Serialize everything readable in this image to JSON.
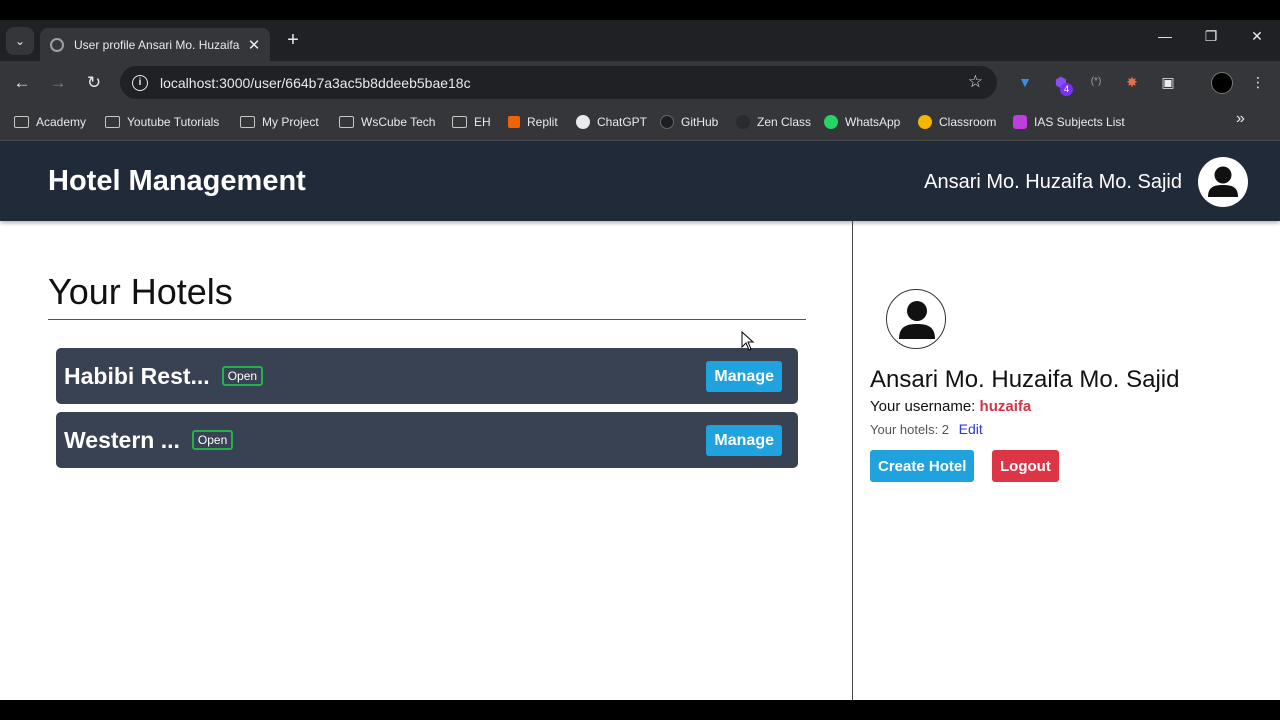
{
  "browser": {
    "tab_title": "User profile Ansari Mo. Huzaifa",
    "url": "localhost:3000/user/664b7a3ac5b8ddeeb5bae18c",
    "extension_badge_count": "4",
    "bookmarks": [
      {
        "label": "Academy",
        "icon": "folder-icon"
      },
      {
        "label": "Youtube Tutorials",
        "icon": "folder-icon"
      },
      {
        "label": "My Project",
        "icon": "folder-icon"
      },
      {
        "label": "WsCube Tech",
        "icon": "folder-icon"
      },
      {
        "label": "EH",
        "icon": "folder-icon"
      },
      {
        "label": "Replit",
        "icon": "replit-icon"
      },
      {
        "label": "ChatGPT",
        "icon": "chatgpt-icon"
      },
      {
        "label": "GitHub",
        "icon": "github-icon"
      },
      {
        "label": "Zen Class",
        "icon": "zen-icon"
      },
      {
        "label": "WhatsApp",
        "icon": "whatsapp-icon"
      },
      {
        "label": "Classroom",
        "icon": "classroom-icon"
      },
      {
        "label": "IAS Subjects List",
        "icon": "notion-icon"
      }
    ]
  },
  "navbar": {
    "brand": "Hotel Management",
    "user_name": "Ansari Mo. Huzaifa Mo. Sajid"
  },
  "hotels": {
    "title": "Your Hotels",
    "items": [
      {
        "name": "Habibi Rest...",
        "status": "Open",
        "action": "Manage"
      },
      {
        "name": "Western ...",
        "status": "Open",
        "action": "Manage"
      }
    ]
  },
  "profile": {
    "name": "Ansari Mo. Huzaifa Mo. Sajid",
    "username_label": "Your username:",
    "username": "huzaifa",
    "hotels_label": "Your hotels: 2",
    "edit_label": "Edit",
    "create_label": "Create Hotel",
    "logout_label": "Logout"
  },
  "colors": {
    "navbar_bg": "#212a39",
    "card_bg": "#394252",
    "primary": "#1fa2de",
    "danger": "#dc3545",
    "open_badge": "#22b14c"
  }
}
